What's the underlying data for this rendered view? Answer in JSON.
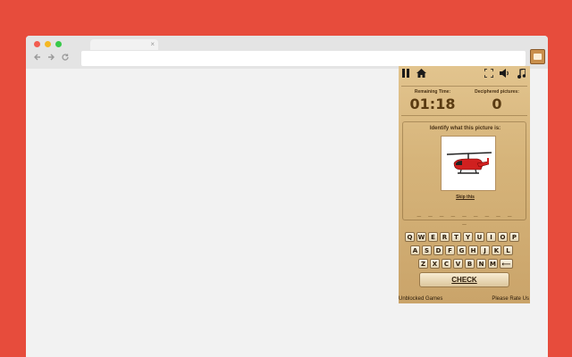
{
  "browser": {
    "tab": {
      "close_glyph": "×"
    },
    "nav": {
      "back_icon": "arrow-left-icon",
      "forward_icon": "arrow-right-icon",
      "reload_icon": "reload-icon"
    },
    "extension": {
      "icon": "picture-extension-icon"
    }
  },
  "game": {
    "toolbar": {
      "pause_icon": "pause-icon",
      "home_icon": "home-icon",
      "fullscreen_icon": "fullscreen-icon",
      "sound_icon": "speaker-icon",
      "music_icon": "music-note-icon"
    },
    "stats": {
      "remaining_label": "Remaining Time:",
      "remaining_value": "01:18",
      "deciphered_label": "Deciphered pictures:",
      "deciphered_value": "0"
    },
    "puzzle": {
      "prompt": "Identify what this picture is:",
      "picture": "helicopter-image",
      "skip_label": "Skip this",
      "blanks": "_ _ _ _ _ _ _ _ _ _"
    },
    "keyboard": {
      "rows": [
        [
          "Q",
          "W",
          "E",
          "R",
          "T",
          "Y",
          "U",
          "I",
          "O",
          "P"
        ],
        [
          "A",
          "S",
          "D",
          "F",
          "G",
          "H",
          "J",
          "K",
          "L"
        ],
        [
          "Z",
          "X",
          "C",
          "V",
          "B",
          "N",
          "M",
          "⟵"
        ]
      ]
    },
    "check_label": "CHECK",
    "footer_left": "Unblocked Games",
    "footer_right": "Please Rate Us"
  },
  "colors": {
    "page_bg": "#e74c3c",
    "parchment": "#d6b47a",
    "stat_text": "#5a3b12"
  }
}
